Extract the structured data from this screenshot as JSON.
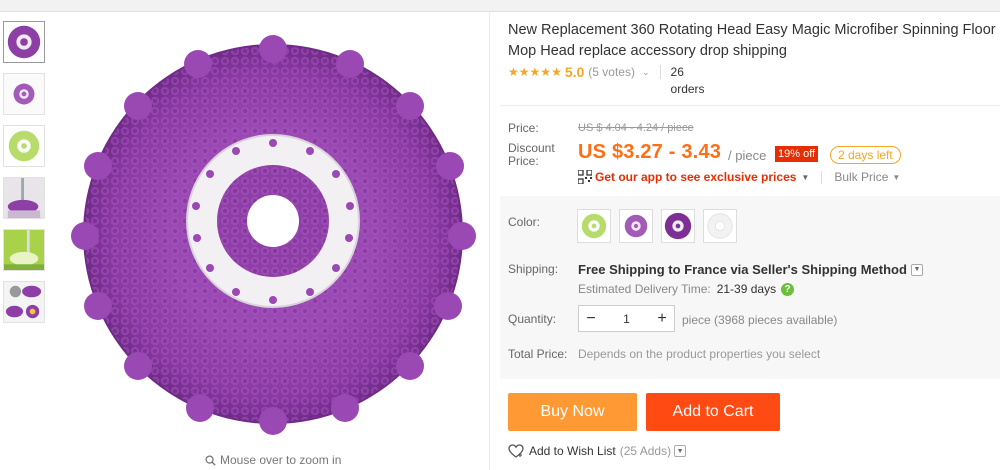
{
  "product": {
    "title": "New Replacement 360 Rotating Head Easy Magic Microfiber Spinning Floor Mop Head replace accessory drop shipping",
    "rating": "5.0",
    "votes": "(5 votes)",
    "orders": "26 orders"
  },
  "gallery": {
    "zoom_hint": "Mouse over to zoom in",
    "thumbnails": [
      "purple-mop-head",
      "purple-mop-small",
      "green-mop-head",
      "mop-bucket-purple",
      "mop-bucket-green",
      "mop-heads-set"
    ]
  },
  "pricing": {
    "price_label": "Price:",
    "original_price": "US $ 4.04 - 4.24 / piece",
    "discount_label": "Discount Price:",
    "discount_price": "US $3.27 - 3.43",
    "unit": "/ piece",
    "off_badge": "19% off",
    "days_left": "2 days left",
    "app_promo": "Get our app to see exclusive prices",
    "bulk_price": "Bulk Price"
  },
  "options": {
    "color_label": "Color:",
    "swatches": [
      "green",
      "purple-light",
      "purple-dark",
      "white"
    ],
    "shipping_label": "Shipping:",
    "shipping_prefix": "Free Shipping to",
    "shipping_country": "France",
    "shipping_via": "via Seller's Shipping Method",
    "estimated_label": "Estimated Delivery Time:",
    "estimated_value": "21-39 days",
    "quantity_label": "Quantity:",
    "quantity_value": "1",
    "quantity_available": "piece (3968 pieces available)",
    "total_label": "Total Price:",
    "total_value": "Depends on the product properties you select"
  },
  "actions": {
    "buy_now": "Buy Now",
    "add_to_cart": "Add to Cart",
    "wish_list": "Add to Wish List",
    "wish_count": "(25 Adds)"
  },
  "colors": {
    "accent_orange": "#ff6e13",
    "buy_now_bg": "#ff9933",
    "cart_bg": "#ff4a14",
    "badge_red": "#e62e04",
    "star": "#f5a623",
    "mop_purple": "#8e3fa6"
  }
}
